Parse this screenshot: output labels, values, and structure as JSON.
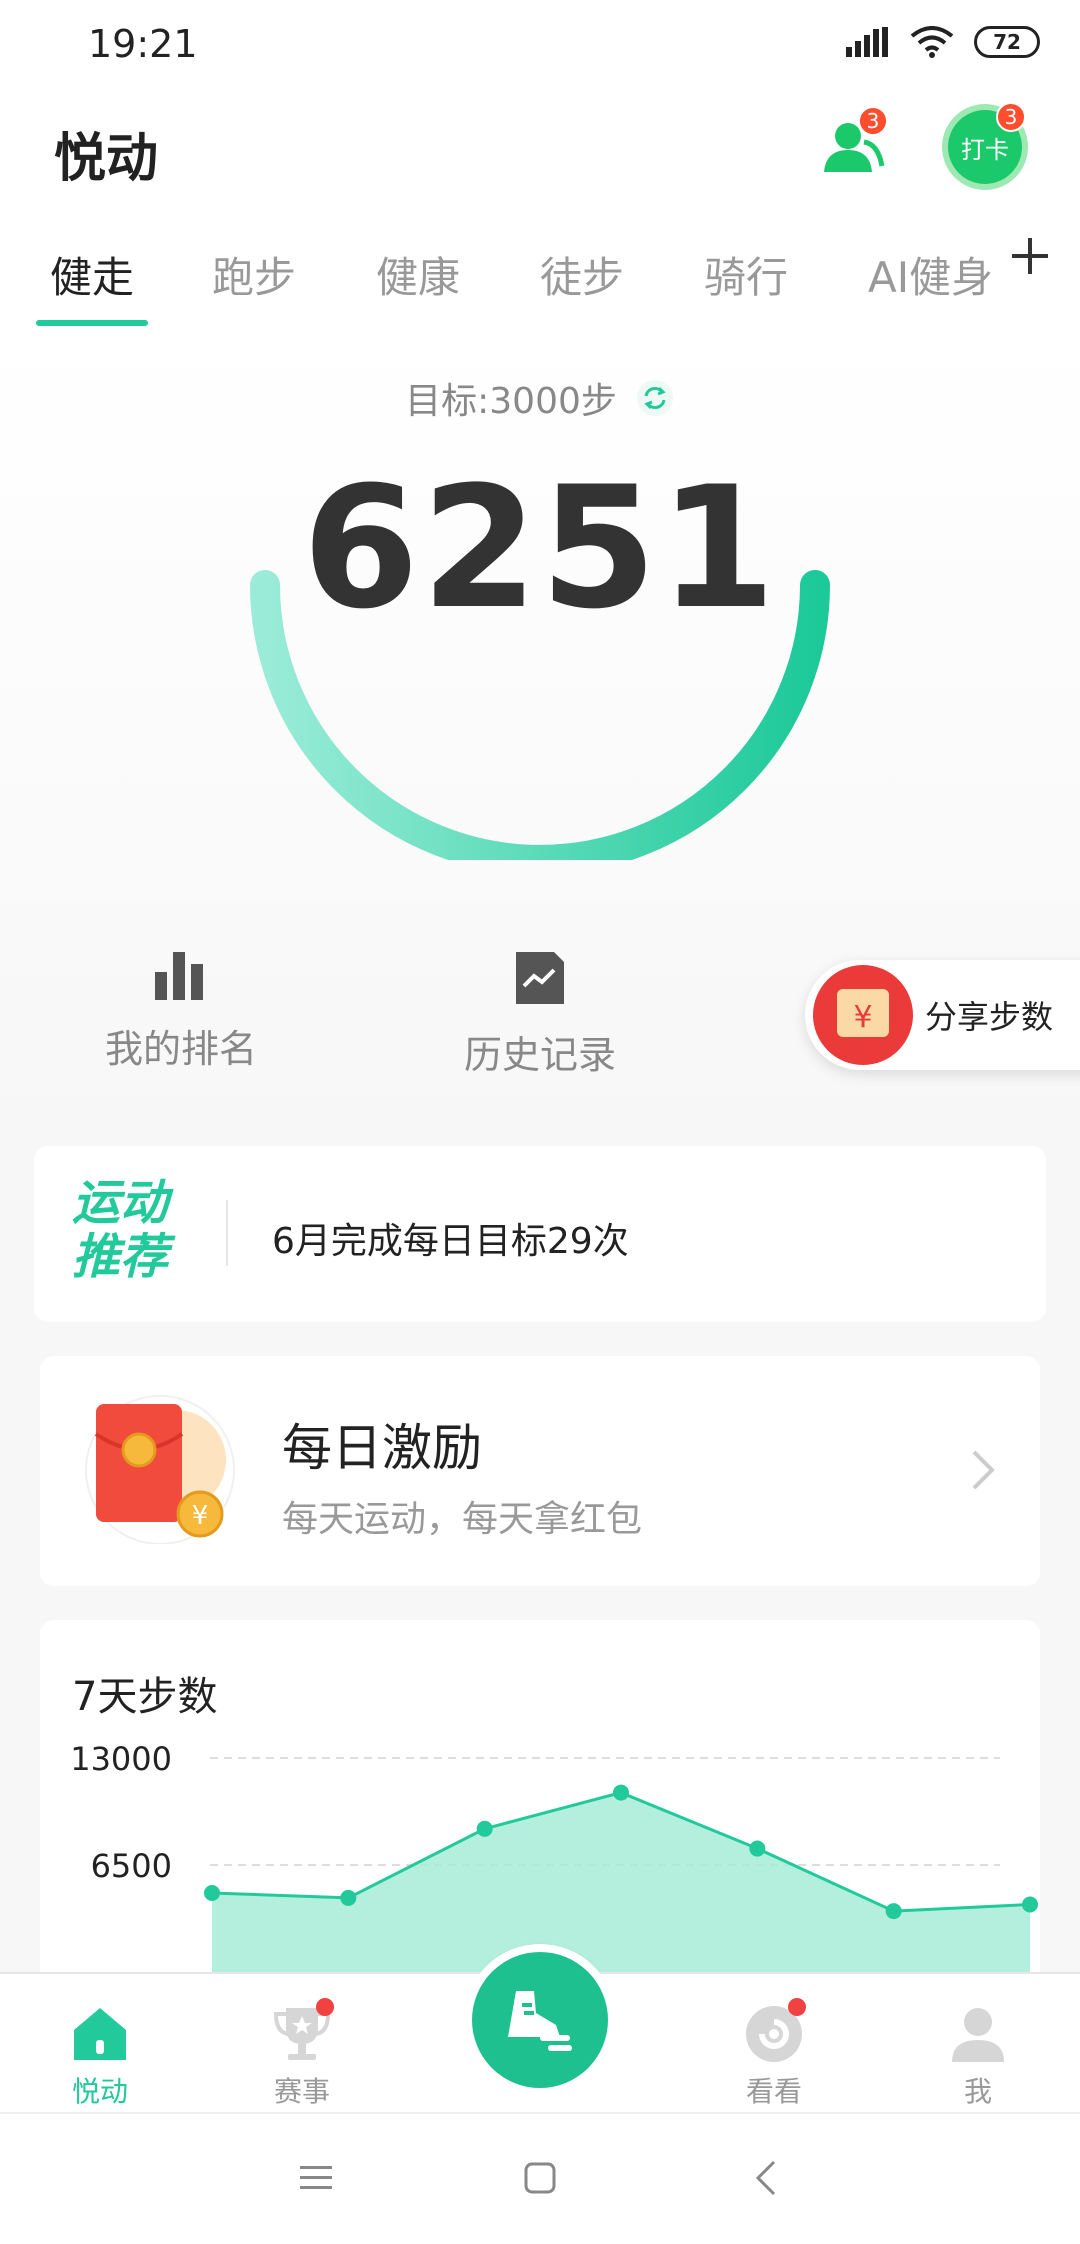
{
  "status_bar": {
    "time": "19:21",
    "battery": "72"
  },
  "header": {
    "title": "悦动",
    "friends_badge": "3",
    "checkin_label": "打卡",
    "checkin_badge": "3"
  },
  "tabs": [
    {
      "label": "健走",
      "active": true
    },
    {
      "label": "跑步"
    },
    {
      "label": "健康"
    },
    {
      "label": "徒步"
    },
    {
      "label": "骑行"
    },
    {
      "label": "AI健身"
    }
  ],
  "hero": {
    "goal": "目标:3000步",
    "steps": "6251",
    "goal_progress": 1.0,
    "accent_color": "#21c99b"
  },
  "actions": {
    "rank": "我的排名",
    "history": "历史记录",
    "share": "分享步数"
  },
  "recommend": {
    "logo_line1": "运动",
    "logo_line2": "推荐",
    "text": "6月完成每日目标29次"
  },
  "reward": {
    "title": "每日激励",
    "subtitle": "每天运动，每天拿红包"
  },
  "chart": {
    "title": "7天步数"
  },
  "chart_data": {
    "type": "area",
    "title": "7天步数",
    "x": [
      1,
      2,
      3,
      4,
      5,
      6,
      7
    ],
    "values": [
      4800,
      4500,
      8700,
      10900,
      7500,
      3700,
      4100
    ],
    "yticks": [
      13000,
      6500
    ],
    "ylim": [
      0,
      15000
    ],
    "grid": true,
    "color": "#21c99b"
  },
  "bottom_nav": [
    {
      "label": "悦动",
      "active": true
    },
    {
      "label": "赛事"
    },
    {
      "label": "看看"
    },
    {
      "label": "我"
    }
  ]
}
